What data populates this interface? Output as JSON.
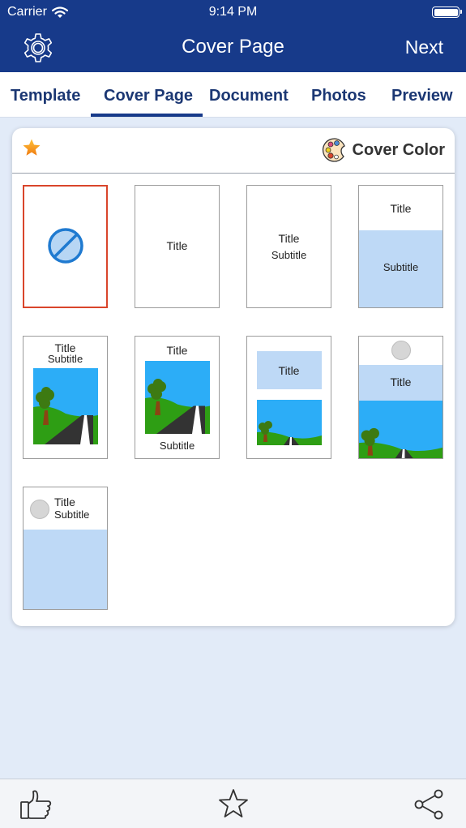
{
  "status_bar": {
    "carrier": "Carrier",
    "time": "9:14 PM",
    "wifi_icon": "wifi-icon",
    "battery_icon": "battery-full-icon"
  },
  "nav": {
    "title": "Cover Page",
    "left_icon": "gear-icon",
    "right_button": "Next"
  },
  "tabs": [
    {
      "label": "Template",
      "active": false
    },
    {
      "label": "Cover Page",
      "active": true
    },
    {
      "label": "Document",
      "active": false
    },
    {
      "label": "Photos",
      "active": false
    },
    {
      "label": "Preview",
      "active": false
    }
  ],
  "card": {
    "favorite_icon": "star-filled-icon",
    "cover_color_label": "Cover Color",
    "cover_color_icon": "palette-icon"
  },
  "templates": [
    {
      "id": "none",
      "selected": true,
      "icon": "no-cover-icon"
    },
    {
      "id": "title-only",
      "title": "Title"
    },
    {
      "id": "title-subtitle",
      "title": "Title",
      "subtitle": "Subtitle"
    },
    {
      "id": "title-blue-subtitle",
      "title": "Title",
      "subtitle": "Subtitle"
    },
    {
      "id": "title-subtitle-photo",
      "title": "Title",
      "subtitle": "Subtitle"
    },
    {
      "id": "title-photo-subtitle",
      "title": "Title",
      "subtitle": "Subtitle"
    },
    {
      "id": "blue-title-photo",
      "title": "Title"
    },
    {
      "id": "logo-title-fullphoto",
      "title": "Title"
    },
    {
      "id": "logo-title-subtitle-blue",
      "title": "Title",
      "subtitle": "Subtitle"
    }
  ],
  "colors": {
    "nav_bg": "#173a8a",
    "tab_text": "#1b3773",
    "selected_border": "#d9452b",
    "light_blue": "#bed9f6",
    "sky": "#2cadf7",
    "grass": "#2e9e14"
  },
  "bottom_bar": {
    "left_icon": "thumbs-up-icon",
    "center_icon": "star-outline-icon",
    "right_icon": "share-icon"
  }
}
